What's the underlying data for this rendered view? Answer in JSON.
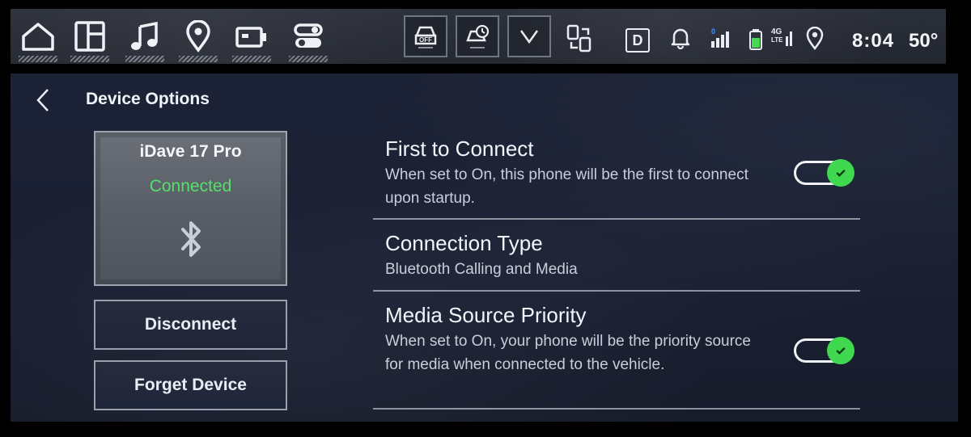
{
  "status_bar": {
    "nav_icons": [
      "home-icon",
      "apps-icon",
      "music-icon",
      "location-icon",
      "camera-icon",
      "settings-icon"
    ],
    "quick_controls": [
      "auto-stop-off-icon",
      "park-assist-icon",
      "chevron-down-icon"
    ],
    "status_icons": [
      "phone-projection-icon",
      "notification-bell-icon",
      "signal-strength-icon",
      "battery-icon",
      "lte-icon",
      "gps-icon"
    ],
    "drive_mode": "D",
    "clock": "8:04",
    "temperature": "50°"
  },
  "page": {
    "title": "Device Options",
    "back_icon": "chevron-left-icon"
  },
  "device": {
    "name": "iDave 17 Pro",
    "status": "Connected",
    "icon": "bluetooth-icon"
  },
  "actions": {
    "disconnect": "Disconnect",
    "forget": "Forget Device"
  },
  "settings": [
    {
      "title": "First to Connect",
      "description": "When set to On, this phone will be the first to connect upon startup.",
      "toggle": true
    },
    {
      "title": "Connection Type",
      "description": "Bluetooth Calling and Media"
    },
    {
      "title": "Media Source Priority",
      "description": "When set to On, your phone will be the priority source for media when connected to the vehicle.",
      "toggle": true
    }
  ],
  "colors": {
    "connected_green": "#55e06a",
    "toggle_on": "#3fd84f",
    "panel_bg": "#1d2336"
  }
}
